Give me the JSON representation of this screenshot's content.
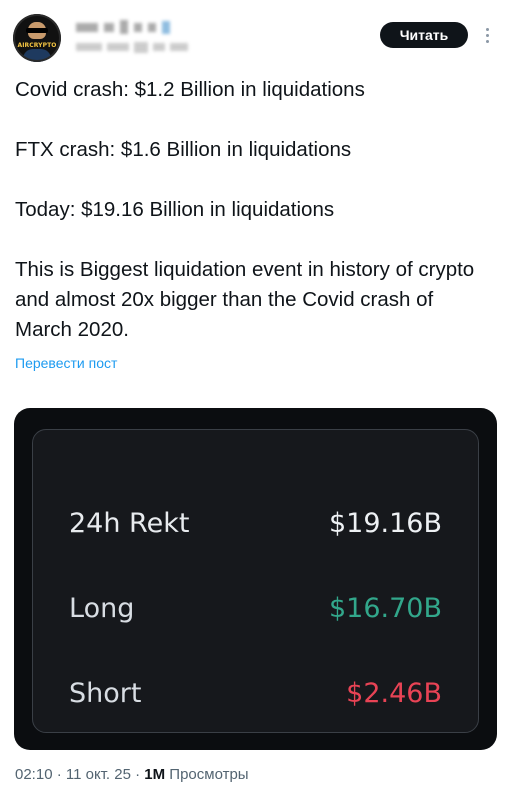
{
  "header": {
    "avatar_text": "AIRCRYPTO",
    "read_button_label": "Читать"
  },
  "tweet": {
    "lines": [
      "Covid crash: $1.2 Billion in liquidations",
      "FTX crash: $1.6 Billion in liquidations",
      "Today: $19.16 Billion in liquidations",
      "This is Biggest liquidation event in history of crypto and almost 20x bigger than the Covid crash of March 2020."
    ],
    "translate_label": "Перевести пост"
  },
  "media": {
    "rows": [
      {
        "label": "24h Rekt",
        "value": "$19.16B"
      },
      {
        "label": "Long",
        "value": "$16.70B"
      },
      {
        "label": "Short",
        "value": "$2.46B"
      }
    ],
    "colors": {
      "total": "#eef1f4",
      "long": "#32a78b",
      "short": "#e84355"
    }
  },
  "footer": {
    "time": "02:10",
    "separator": "·",
    "date": "11 окт. 25",
    "views_count": "1M",
    "views_label": "Просмотры"
  }
}
